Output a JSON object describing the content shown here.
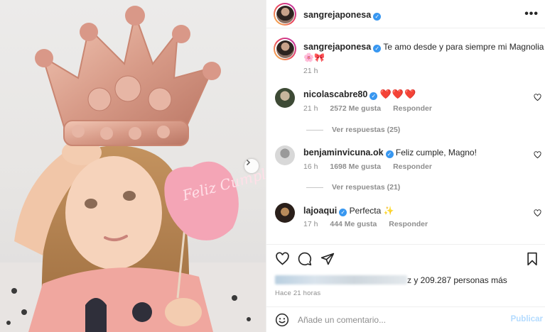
{
  "post": {
    "author": "sangrejaponesa",
    "caption_author": "sangrejaponesa",
    "caption": "Te amo desde y para siempre mi Magnolia",
    "caption_emojis": "🌸🎀",
    "caption_time": "21 h",
    "more_icon": "more-horizontal-icon"
  },
  "photo": {
    "balloon_text": "Feliz Cumple"
  },
  "comments": [
    {
      "user": "nicolascabre80",
      "text": "❤️❤️❤️",
      "time": "21 h",
      "likes": "2572 Me gusta",
      "reply": "Responder",
      "replies": "Ver respuestas (25)"
    },
    {
      "user": "benjaminvicuna.ok",
      "text": "Feliz cumple, Magno!",
      "time": "16 h",
      "likes": "1698 Me gusta",
      "reply": "Responder",
      "replies": "Ver respuestas (21)"
    },
    {
      "user": "lajoaqui",
      "text": "Perfecta ✨",
      "time": "17 h",
      "likes": "444 Me gusta",
      "reply": "Responder"
    }
  ],
  "likes_suffix": "z y 209.287 personas más",
  "time_ago": "Hace 21 horas",
  "composer": {
    "placeholder": "Añade un comentario...",
    "publish_label": "Publicar"
  },
  "colors": {
    "accent": "#3897f0",
    "publish_disabled": "#b3dbff",
    "heart": "#e0245e"
  }
}
